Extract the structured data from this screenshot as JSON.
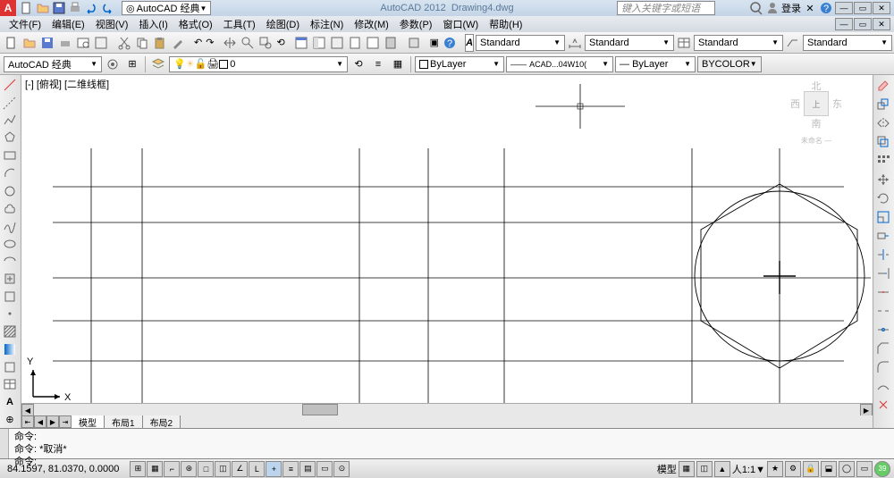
{
  "title": {
    "app": "AutoCAD 2012",
    "doc": "Drawing4.dwg"
  },
  "workspace_selector": "AutoCAD 经典",
  "search_placeholder": "键入关键字或短语",
  "login_label": "登录",
  "menus": [
    "文件(F)",
    "编辑(E)",
    "视图(V)",
    "插入(I)",
    "格式(O)",
    "工具(T)",
    "绘图(D)",
    "标注(N)",
    "修改(M)",
    "参数(P)",
    "窗口(W)",
    "帮助(H)"
  ],
  "toolbar2": {
    "workspace": "AutoCAD 经典",
    "layer_current": "0"
  },
  "styles": {
    "text": "Standard",
    "dim": "Standard",
    "table": "Standard",
    "mleader": "Standard"
  },
  "props": {
    "layer": "ByLayer",
    "linetype": "ACAD...04W10(",
    "lineweight": "ByLayer",
    "plotstyle": "BYCOLOR"
  },
  "view": {
    "label": "[-] [俯视] [二维线框]"
  },
  "viewcube": {
    "n": "北",
    "s": "南",
    "e": "东",
    "w": "西",
    "top": "上",
    "home": "未命名 —"
  },
  "tabs": {
    "model": "模型",
    "layout1": "布局1",
    "layout2": "布局2"
  },
  "cmd": {
    "line1": "命令:",
    "line2": "命令: *取消*",
    "line3": "命令:"
  },
  "status": {
    "coords": "84.1597, 81.0370, 0.0000",
    "modelspace": "模型",
    "scale": "1:1"
  },
  "ucs": {
    "x": "X",
    "y": "Y"
  },
  "icons": {
    "new": "□",
    "open": "📂",
    "save": "💾",
    "print": "🖨",
    "undo": "↶",
    "redo": "↷"
  }
}
